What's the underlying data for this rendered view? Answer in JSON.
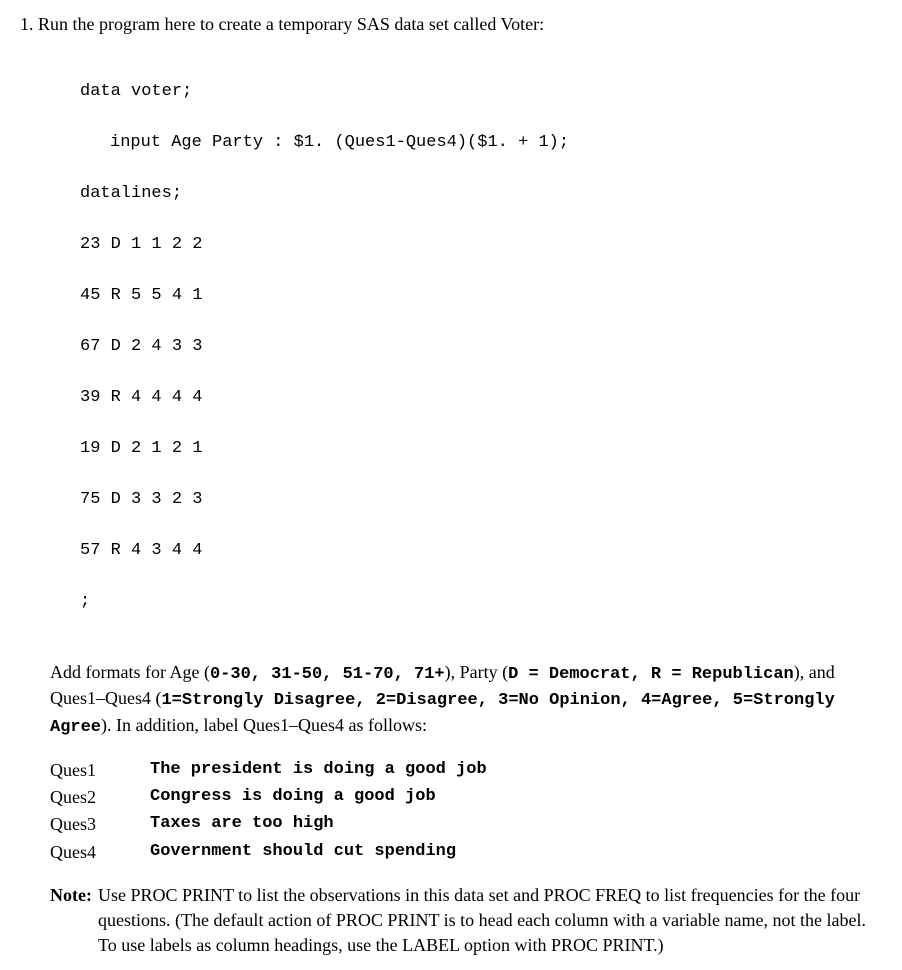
{
  "question": {
    "number": "1.",
    "prompt": "Run the program here to create a temporary SAS data set called Voter:"
  },
  "code": {
    "line1": "data voter;",
    "line2": "input Age Party : $1. (Ques1-Ques4)($1. + 1);",
    "line3": "datalines;",
    "d1": "23 D 1 1 2 2",
    "d2": "45 R 5 5 4 1",
    "d3": "67 D 2 4 3 3",
    "d4": "39 R 4 4 4 4",
    "d5": "19 D 2 1 2 1",
    "d6": "75 D 3 3 2 3",
    "d7": "57 R 4 3 4 4",
    "semi": ";"
  },
  "instructions": {
    "pre1": "Add formats for Age (",
    "ageFmt": "0-30, 31-50, 51-70, 71+",
    "pre2": "), Party (",
    "partyFmt": "D = Democrat, R = Republican",
    "pre3": "), and Ques1–Ques4 (",
    "quesFmt": "1=Strongly Disagree, 2=Disagree, 3=No Opinion, 4=Agree, 5=Strongly Agree",
    "post": "). In addition, label Ques1–Ques4 as follows:"
  },
  "labels": {
    "items": [
      {
        "name": "Ques1",
        "desc": "The president is doing a good job"
      },
      {
        "name": "Ques2",
        "desc": "Congress is doing a good job"
      },
      {
        "name": "Ques3",
        "desc": "Taxes are too high"
      },
      {
        "name": "Ques4",
        "desc": "Government should cut spending"
      }
    ]
  },
  "note": {
    "label": "Note:",
    "text": "Use PROC PRINT to list the observations in this data set and PROC FREQ to list frequencies for the four questions. (The default action of PROC PRINT is to head each column with a variable name, not the label. To use labels as column headings, use the LABEL option with PROC PRINT.)"
  }
}
